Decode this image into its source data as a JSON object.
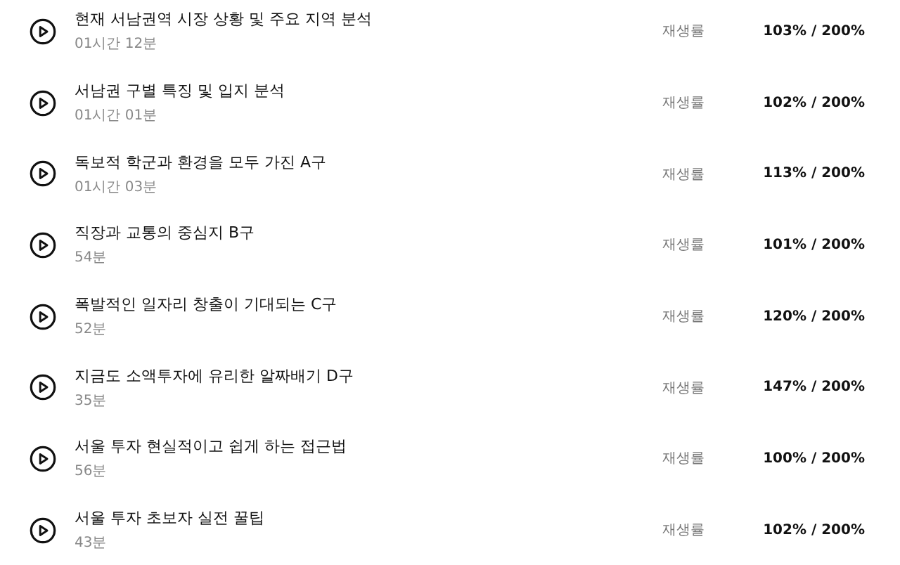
{
  "lessons": [
    {
      "title": "현재 서남권역 시장 상황 및 주요 지역 분석",
      "duration": "01시간 12분",
      "rate_label": "재생률",
      "rate": "103% / 200%"
    },
    {
      "title": "서남권 구별 특징 및 입지 분석",
      "duration": "01시간 01분",
      "rate_label": "재생률",
      "rate": "102% / 200%"
    },
    {
      "title": "독보적 학군과 환경을 모두 가진 A구",
      "duration": "01시간 03분",
      "rate_label": "재생률",
      "rate": "113% / 200%"
    },
    {
      "title": "직장과 교통의 중심지 B구",
      "duration": "54분",
      "rate_label": "재생률",
      "rate": "101% / 200%"
    },
    {
      "title": "폭발적인 일자리 창출이 기대되는 C구",
      "duration": "52분",
      "rate_label": "재생률",
      "rate": "120% / 200%"
    },
    {
      "title": "지금도 소액투자에 유리한 알짜배기 D구",
      "duration": "35분",
      "rate_label": "재생률",
      "rate": "147% / 200%"
    },
    {
      "title": "서울 투자 현실적이고 쉽게 하는 접근법",
      "duration": "56분",
      "rate_label": "재생률",
      "rate": "100% / 200%"
    },
    {
      "title": "서울 투자 초보자 실전 꿀팁",
      "duration": "43분",
      "rate_label": "재생률",
      "rate": "102% / 200%"
    }
  ]
}
